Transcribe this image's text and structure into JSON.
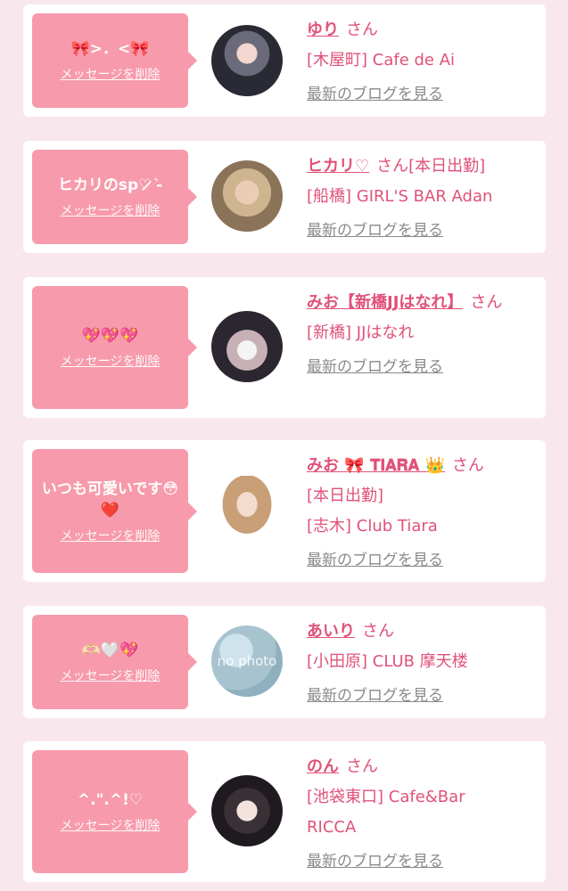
{
  "cards": [
    {
      "message": "🎀>．<🎀",
      "delete_label": "メッセージを削除",
      "name": "ゆり",
      "san": "さん",
      "extra": "",
      "shop_line1": "[木屋町] Cafe de Ai",
      "shop_line2": "",
      "blog_label": "最新のブログを見る"
    },
    {
      "message": "ヒカリのsp♡̷̷̷ ͛-",
      "delete_label": "メッセージを削除",
      "name": "ヒカリ♡",
      "san": "さん",
      "extra": "[本日出勤]",
      "shop_line1": "[船橋] GIRL'S BAR Adan",
      "shop_line2": "",
      "blog_label": "最新のブログを見る"
    },
    {
      "message": "💖💖💖",
      "delete_label": "メッセージを削除",
      "name": "みお【新橋JJはなれ】",
      "san": "さん",
      "extra": "",
      "shop_line1": "[新橋] JJはなれ",
      "shop_line2": "",
      "blog_label": "最新のブログを見る"
    },
    {
      "message": "いつも可愛いです😳❤️",
      "delete_label": "メッセージを削除",
      "name": "みお 🎀 𝐓𝐈𝐀𝐑𝐀 👑",
      "san": "さん",
      "extra": "[本日出勤]",
      "shop_line1": "[志木] Club Tiara",
      "shop_line2": "",
      "blog_label": "最新のブログを見る"
    },
    {
      "message": "🫶🏻🤍💖",
      "delete_label": "メッセージを削除",
      "name": "あいり",
      "san": "さん",
      "extra": "",
      "shop_line1": "[小田原] CLUB 摩天楼",
      "shop_line2": "",
      "blog_label": "最新のブログを見る",
      "no_photo_text": "no photo"
    },
    {
      "message": "^.\".^!♡",
      "delete_label": "メッセージを削除",
      "name": "のん",
      "san": "さん",
      "extra": "",
      "shop_line1": "[池袋東口] Cafe&Bar",
      "shop_line2": "RICCA",
      "blog_label": "最新のブログを見る"
    }
  ],
  "colors": {
    "page_bg": "#f8e8ee",
    "bubble": "#f79aac",
    "accent": "#e0527a",
    "link_gray": "#8a8a8a"
  }
}
